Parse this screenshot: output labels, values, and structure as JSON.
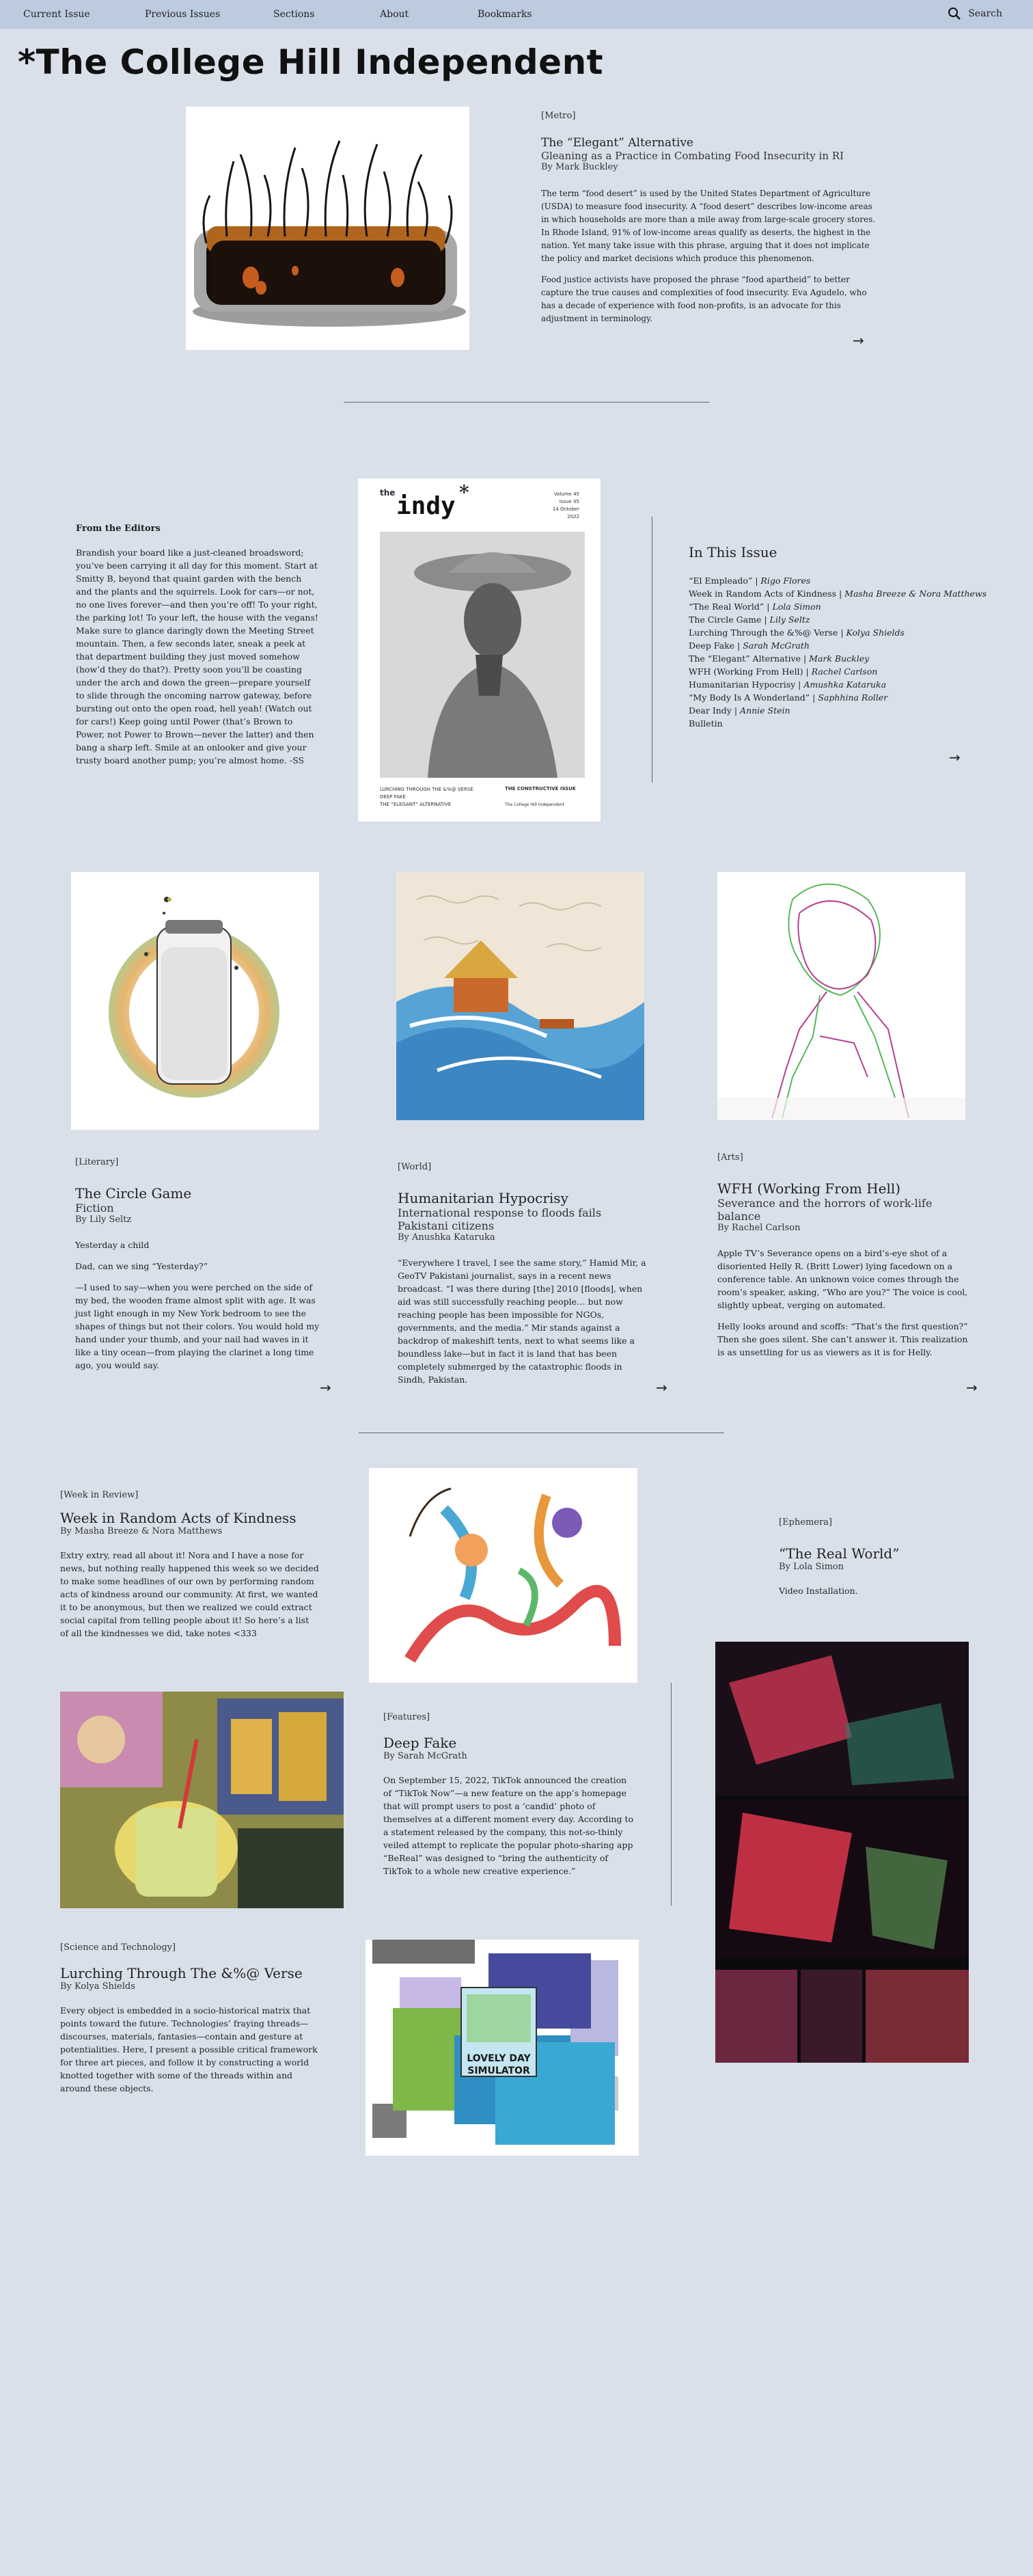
{
  "nav": {
    "items": [
      "Current Issue",
      "Previous Issues",
      "Sections",
      "About",
      "Bookmarks"
    ],
    "search_label": "Search"
  },
  "masthead": "*The College Hill Independent",
  "feature": {
    "section": "[Metro]",
    "title": "The “Elegant” Alternative",
    "subtitle": "Gleaning as a Practice in Combating Food Insecurity in RI",
    "byline": "By Mark Buckley",
    "paragraphs": [
      "The term “food desert” is used by the United States Department of Agriculture (USDA) to measure food insecurity. A “food desert” describes low-income areas in which households are more than a mile away from large-scale grocery stores. In Rhode Island, 91% of low-income areas qualify as deserts, the highest in the nation. Yet many take issue with this phrase, arguing that it does not implicate the policy and market decisions which produce this phenomenon.",
      "Food justice activists have proposed the phrase “food apartheid” to better capture the true causes and complexities of food insecurity. Eva Agudelo, who has a decade of experience with food non-profits, is an advocate for this adjustment in terminology."
    ]
  },
  "editors": {
    "title": "From the Editors",
    "text": "Brandish your board like a just-cleaned broadsword; you’ve been carrying it all day for this moment. Start at Smitty B, beyond that quaint garden with the bench and the plants and the squirrels. Look for cars—or not, no one lives forever—and then you’re off! To your right, the parking lot! To your left, the house with the vegans! Make sure to glance daringly down the Meeting Street mountain. Then, a few seconds later, sneak a peek at that department building they just moved somehow (how’d they do that?). Pretty soon you’ll be coasting under the arch and down the green—prepare yourself to slide through the oncoming narrow gateway, before bursting out onto the open road, hell yeah! (Watch out for cars!) Keep going until Power (that’s Brown to Power, not Power to Brown—never the latter) and then bang a sharp left. Smile at an onlooker and give your trusty board another pump; you’re almost home. -SS"
  },
  "cover": {
    "logo_small": "the",
    "logo": "indy",
    "meta": [
      "Volume 45",
      "Issue 05",
      "14 October 2022"
    ],
    "contents": [
      "LURCHING THROUGH THE &%@ VERSE",
      "DEEP FAKE",
      "THE “ELEGANT” ALTERNATIVE"
    ],
    "theme": "THE CONSTRUCTIVE ISSUE",
    "footer": "The College Hill Independent"
  },
  "toc": {
    "title": "In This Issue",
    "items": [
      {
        "title": "“El Empleado”",
        "author": "Rigo Flores"
      },
      {
        "title": "Week in Random Acts of Kindness",
        "author": "Masha Breeze & Nora Matthews"
      },
      {
        "title": "“The Real World”",
        "author": "Lola Simon"
      },
      {
        "title": "The Circle Game",
        "author": "Lily Seltz"
      },
      {
        "title": "Lurching Through the &%@ Verse",
        "author": "Kolya Shields"
      },
      {
        "title": "Deep Fake",
        "author": "Sarah McGrath"
      },
      {
        "title": "The “Elegant” Alternative",
        "author": "Mark Buckley"
      },
      {
        "title": "WFH (Working From Hell)",
        "author": "Rachel Carlson"
      },
      {
        "title": "Humanitarian Hypocrisy",
        "author": "Amushka Kataruka"
      },
      {
        "title": "“My Body Is A Wonderland”",
        "author": "Saphhina Roller"
      },
      {
        "title": "Dear Indy",
        "author": "Annie Stein"
      },
      {
        "title": "Bulletin",
        "author": ""
      }
    ]
  },
  "row3": [
    {
      "section": "[Literary]",
      "title": "The Circle Game",
      "subtitle": "Fiction",
      "byline": "By Lily Seltz",
      "paragraphs": [
        "Yesterday a child",
        "Dad, can we sing “Yesterday?”",
        "—I used to say—when you were perched on the side of my bed, the wooden frame almost split with age. It was just light enough in my New York bedroom to see the shapes of things but not their colors. You would hold my hand under your thumb, and your nail had waves in it like a tiny ocean—from playing the clarinet a long time ago, you would say."
      ]
    },
    {
      "section": "[World]",
      "title": "Humanitarian Hypocrisy",
      "subtitle": "International response to floods fails Pakistani citizens",
      "byline": "By Anushka Kataruka",
      "paragraphs": [
        "“Everywhere I travel, I see the same story,” Hamid Mir, a GeoTV Pakistani journalist, says in a recent news broadcast. “I was there during [the] 2010 [floods], when aid was still successfully reaching people… but now reaching people has been impossible for NGOs, governments, and the media.” Mir stands against a backdrop of makeshift tents, next to what seems like a boundless lake—but in fact it is land that has been completely submerged by the catastrophic floods in Sindh, Pakistan."
      ]
    },
    {
      "section": "[Arts]",
      "title": "WFH (Working From Hell)",
      "subtitle": "Severance and the horrors of work-life balance",
      "byline": "By Rachel Carlson",
      "paragraphs": [
        "Apple TV’s Severance opens on a bird’s-eye shot of a disoriented Helly R. (Britt Lower) lying facedown on a conference table. An unknown voice comes through the room’s speaker, asking, “Who are you?” The voice is cool, slightly upbeat, verging on automated.",
        "Helly looks around and scoffs: “That’s the first question?” Then she goes silent. She can’t answer it. This realization is as unsettling for us as viewers as it is for Helly."
      ]
    }
  ],
  "week": {
    "section": "[Week in Review]",
    "title": "Week in Random Acts of Kindness",
    "byline": "By Masha Breeze & Nora Matthews",
    "text": "Extry extry, read all about it! Nora and I have a nose for news, but nothing really happened this week so we decided to make some headlines of our own by performing random acts of kindness around our community. At first, we wanted it to be anonymous, but then we realized we could extract social capital from telling people about it! So here’s a list of all the kindnesses we did, take notes <333"
  },
  "lurching": {
    "section": "[Science and Technology]",
    "title": "Lurching Through The &%@ Verse",
    "byline": "By Kolya Shields",
    "text": "Every object is embedded in a socio-historical matrix that points toward the future. Technologies’ fraying threads—discourses, materials, fantasies—contain and gesture at potentialities. Here, I present a possible critical framework for three art pieces, and follow it by constructing a world knotted together with some of the threads within and around these objects."
  },
  "deepfake": {
    "section": "[Features]",
    "title": "Deep Fake",
    "byline": "By Sarah McGrath",
    "text": "On September 15, 2022, TikTok announced the creation of “TikTok Now”—a new feature on the app’s homepage that will prompt users to post a ‘candid’ photo of themselves at a different moment every day. According to a statement released by the company, this not-so-thinly veiled attempt to replicate the popular photo-sharing app “BeReal” was designed to “bring the authenticity of TikTok to a whole new creative experience.”",
    "art_text": [
      "LOVELY DAY",
      "SIMULATOR"
    ]
  },
  "ephemera": {
    "section": "[Ephemera]",
    "title": "“The Real World”",
    "byline": "By Lola Simon",
    "text": "Video Installation."
  },
  "colors": {
    "page_bg": "#d9e0ea",
    "nav_bg": "#bccbde",
    "text": "#2a2f36"
  }
}
